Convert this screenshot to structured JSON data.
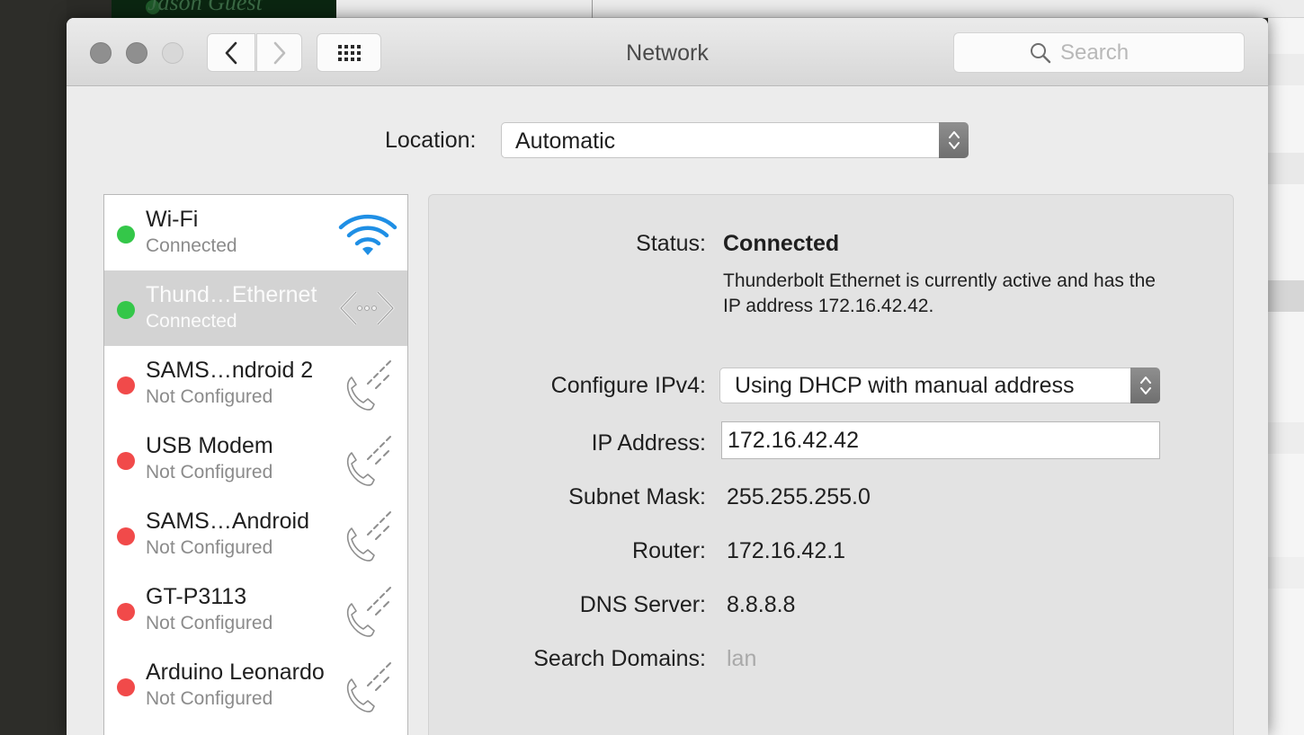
{
  "background": {
    "app_label": "Jason Guest"
  },
  "window": {
    "title": "Network",
    "search": {
      "placeholder": "Search"
    }
  },
  "location": {
    "label": "Location:",
    "value": "Automatic"
  },
  "services": [
    {
      "name": "Wi-Fi",
      "status": "Connected",
      "status_color": "#34c749",
      "icon": "wifi-icon",
      "selected": false
    },
    {
      "name": "Thund…Ethernet",
      "status": "Connected",
      "status_color": "#34c749",
      "icon": "ethernet-icon",
      "selected": true
    },
    {
      "name": "SAMS…ndroid 2",
      "status": "Not Configured",
      "status_color": "#f14a4a",
      "icon": "phone-icon",
      "selected": false
    },
    {
      "name": "USB Modem",
      "status": "Not Configured",
      "status_color": "#f14a4a",
      "icon": "phone-icon",
      "selected": false
    },
    {
      "name": "SAMS…Android",
      "status": "Not Configured",
      "status_color": "#f14a4a",
      "icon": "phone-icon",
      "selected": false
    },
    {
      "name": "GT-P3113",
      "status": "Not Configured",
      "status_color": "#f14a4a",
      "icon": "phone-icon",
      "selected": false
    },
    {
      "name": "Arduino Leonardo",
      "status": "Not Configured",
      "status_color": "#f14a4a",
      "icon": "phone-icon",
      "selected": false
    }
  ],
  "details": {
    "status": {
      "label": "Status:",
      "value": "Connected",
      "description": "Thunderbolt Ethernet is currently active and has the IP address 172.16.42.42."
    },
    "configure_ipv4": {
      "label": "Configure IPv4:",
      "value": "Using DHCP with manual address"
    },
    "ip_address": {
      "label": "IP Address:",
      "value": "172.16.42.42"
    },
    "subnet_mask": {
      "label": "Subnet Mask:",
      "value": "255.255.255.0"
    },
    "router": {
      "label": "Router:",
      "value": "172.16.42.1"
    },
    "dns_server": {
      "label": "DNS Server:",
      "value": "8.8.8.8"
    },
    "search_domains": {
      "label": "Search Domains:",
      "value": "lan"
    }
  },
  "colors": {
    "connected": "#34c749",
    "not_configured": "#f14a4a",
    "wifi_blue": "#1f8fe5"
  }
}
